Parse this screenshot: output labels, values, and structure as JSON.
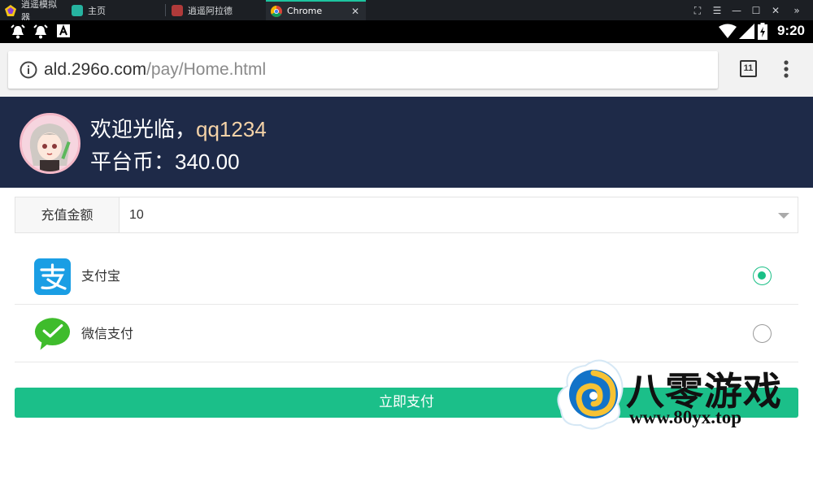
{
  "emulator": {
    "tabs": [
      {
        "label": "逍遥模拟器"
      },
      {
        "label": "主页"
      },
      {
        "label": "逍遥阿拉德"
      },
      {
        "label": "Chrome"
      }
    ],
    "colors": {
      "bar": "#1c1f24",
      "active_tab_accent": "#1dc4a0"
    }
  },
  "status_bar": {
    "time": "9:20",
    "left_icons": [
      "alarm-icon",
      "alarm-icon",
      "font-icon"
    ],
    "right_icons": [
      "wifi-icon",
      "signal-icon",
      "battery-icon"
    ]
  },
  "browser": {
    "url_host": "ald.296o.com",
    "url_path": "/pay/Home.html",
    "tab_count": "11"
  },
  "header": {
    "welcome_prefix": "欢迎光临，",
    "username": "qq1234",
    "balance_prefix": "平台币：",
    "balance": "340.00",
    "colors": {
      "background": "#1e2a48",
      "username": "#f5d3a8"
    }
  },
  "amount": {
    "label": "充值金额",
    "value": "10"
  },
  "payment_methods": [
    {
      "label": "支付宝",
      "icon": "alipay-icon",
      "selected": true
    },
    {
      "label": "微信支付",
      "icon": "wechat-icon",
      "selected": false
    }
  ],
  "pay_button": {
    "label": "立即支付",
    "color": "#1bbf89"
  },
  "watermark": {
    "title": "八零游戏",
    "url": "www.80yx.top"
  }
}
